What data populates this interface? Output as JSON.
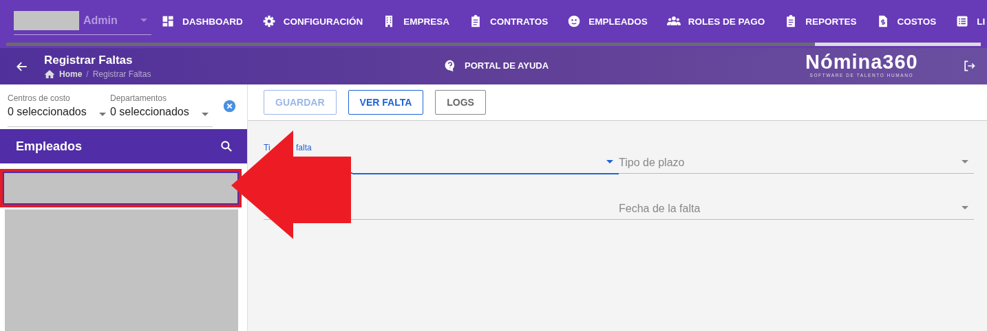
{
  "user_menu": {
    "role": "Admin"
  },
  "nav": [
    {
      "label": "DASHBOARD",
      "kind": "dashboard"
    },
    {
      "label": "CONFIGURACIÓN",
      "kind": "gear"
    },
    {
      "label": "EMPRESA",
      "kind": "building"
    },
    {
      "label": "CONTRATOS",
      "kind": "clipboard"
    },
    {
      "label": "EMPLEADOS",
      "kind": "face"
    },
    {
      "label": "ROLES DE PAGO",
      "kind": "people"
    },
    {
      "label": "REPORTES",
      "kind": "clipboard"
    },
    {
      "label": "COSTOS",
      "kind": "invoice"
    },
    {
      "label": "LI",
      "kind": "list"
    }
  ],
  "loading": {
    "level": 0.83
  },
  "header": {
    "title": "Registrar Faltas",
    "breadcrumb": [
      "Home",
      "/",
      "Registrar Faltas"
    ],
    "help": "PORTAL DE AYUDA",
    "logo": "Nómina360",
    "logo_tagline": "SOFTWARE DE TALENTO HUMANO"
  },
  "filters": [
    {
      "label": "Centros de costo",
      "value": "0 seleccionados"
    },
    {
      "label": "Departamentos",
      "value": "0 seleccionados"
    }
  ],
  "employees": {
    "title": "Empleados",
    "items": [
      {
        "selected": true
      },
      {
        "selected": false
      }
    ]
  },
  "toolbar": [
    {
      "label": "GUARDAR",
      "disabled": true,
      "primary": false
    },
    {
      "label": "VER FALTA",
      "disabled": false,
      "primary": true
    },
    {
      "label": "LOGS",
      "disabled": false,
      "primary": false
    }
  ],
  "form": [
    {
      "label_parts": [
        "Ti",
        "falta"
      ],
      "focused": true
    },
    {
      "label": "Tipo de plazo",
      "focused": false
    },
    {
      "label": "Fecha de la falta",
      "focused": false
    }
  ]
}
